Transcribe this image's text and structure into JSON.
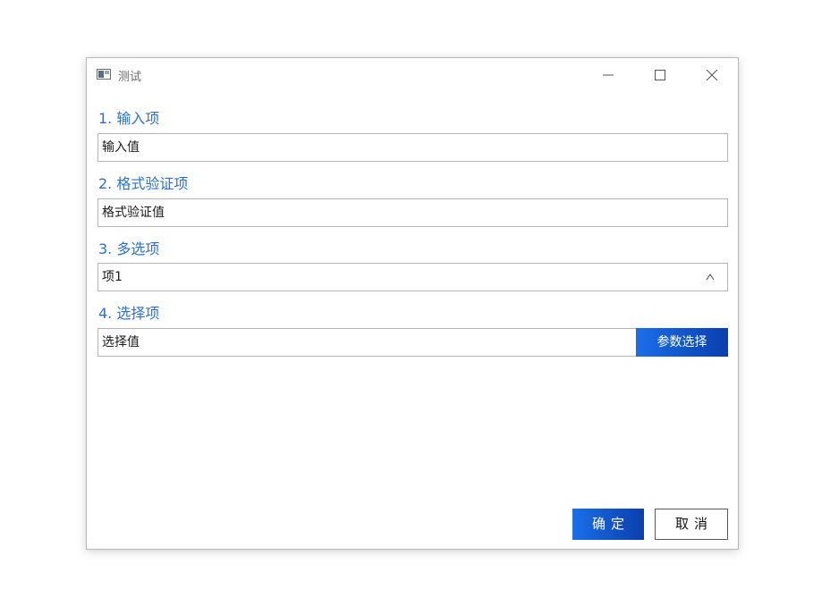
{
  "window": {
    "title": "测试"
  },
  "fields": [
    {
      "label": "1. 输入项",
      "value": "输入值"
    },
    {
      "label": "2. 格式验证项",
      "value": "格式验证值"
    },
    {
      "label": "3. 多选项",
      "value": "项1"
    },
    {
      "label": "4. 选择项",
      "value": "选择值"
    }
  ],
  "buttons": {
    "param_select": "参数选择",
    "ok": "确定",
    "cancel": "取消"
  },
  "icons": {
    "app": "app-window-icon",
    "minimize": "minimize-icon",
    "maximize": "maximize-icon",
    "close": "close-icon",
    "combo_caret": "chevron-up-icon"
  },
  "colors": {
    "label_accent": "#2a6fd6",
    "primary_button_start": "#1a6fe8",
    "primary_button_end": "#0a3fae"
  }
}
